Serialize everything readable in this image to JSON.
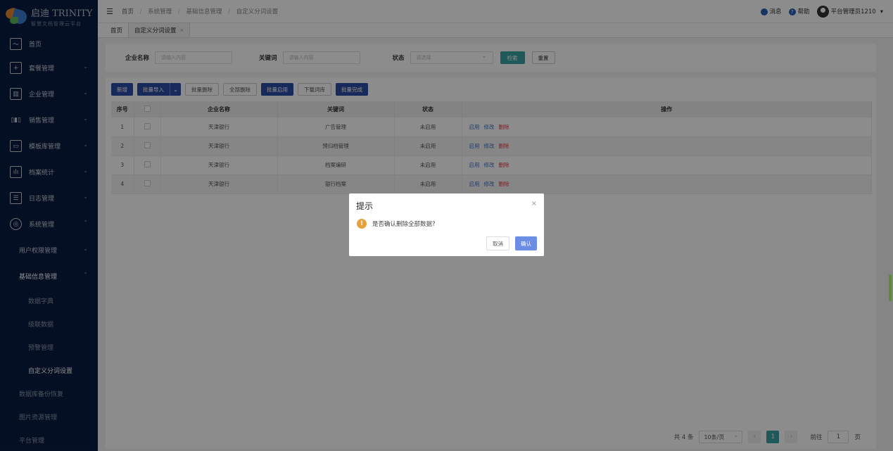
{
  "brand": {
    "title": "启迪 TRINITY",
    "subtitle": "智慧文档管理云平台"
  },
  "sidebar": {
    "items": [
      {
        "label": "首页",
        "icon": "chart-line-icon"
      },
      {
        "label": "套餐管理",
        "icon": "plus-box-icon"
      },
      {
        "label": "企业管理",
        "icon": "building-icon"
      },
      {
        "label": "销售管理",
        "icon": "bar-chart-icon"
      },
      {
        "label": "模板库管理",
        "icon": "template-icon"
      },
      {
        "label": "档案统计",
        "icon": "stats-icon"
      },
      {
        "label": "日志管理",
        "icon": "log-icon"
      },
      {
        "label": "系统管理",
        "icon": "settings-circle-icon"
      }
    ],
    "sub": {
      "user_perm": "用户权限管理",
      "basic_info": "基础信息管理",
      "basic_children": [
        "数据字典",
        "级联数据",
        "预警管理",
        "自定义分词设置"
      ],
      "backup": "数据库备份恢复",
      "image_res": "图片资源管理",
      "more": "平台管理"
    }
  },
  "topbar": {
    "breadcrumb": [
      "首页",
      "系统管理",
      "基础信息管理",
      "自定义分词设置"
    ],
    "messages": "消息",
    "help": "帮助",
    "user": "平台管理员1210"
  },
  "tabs": [
    {
      "label": "首页"
    },
    {
      "label": "自定义分词设置",
      "close": "×"
    }
  ],
  "search": {
    "company_label": "企业名称",
    "company_placeholder": "请输入内容",
    "keyword_label": "关键词",
    "keyword_placeholder": "请输入内容",
    "status_label": "状态",
    "status_placeholder": "请选择",
    "search_btn": "检索",
    "reset_btn": "重置"
  },
  "toolbar": {
    "add": "新增",
    "batch_import": "批量导入",
    "batch_delete": "批量删除",
    "delete_all": "全部删除",
    "batch_enable": "批量启用",
    "download_lib": "下载词库",
    "batch_done": "批量完成"
  },
  "table": {
    "headers": [
      "序号",
      "",
      "企业名称",
      "关键词",
      "状态",
      "操作"
    ],
    "rows": [
      {
        "no": "1",
        "company": "天津银行",
        "keyword": "广告管理",
        "status": "未启用"
      },
      {
        "no": "2",
        "company": "天津银行",
        "keyword": "预归档管理",
        "status": "未启用"
      },
      {
        "no": "3",
        "company": "天津银行",
        "keyword": "档案编研",
        "status": "未启用"
      },
      {
        "no": "4",
        "company": "天津银行",
        "keyword": "银行档案",
        "status": "未启用"
      }
    ],
    "ops": {
      "enable": "启用",
      "edit": "修改",
      "delete": "删除"
    }
  },
  "pager": {
    "total": "共 4 条",
    "page_size": "10条/页",
    "current": "1",
    "goto_label": "前往",
    "goto_value": "1",
    "page_unit": "页",
    "prev": "‹",
    "next": "›"
  },
  "dialog": {
    "title": "提示",
    "message": "是否确认删除全部数据?",
    "cancel": "取消",
    "confirm": "确认",
    "close": "×"
  },
  "colors": {
    "sidebar": "#0a1d43",
    "primary": "#2c4ea8",
    "teal": "#3aa3a3",
    "danger": "#e0393e",
    "warning": "#e6a23c"
  }
}
